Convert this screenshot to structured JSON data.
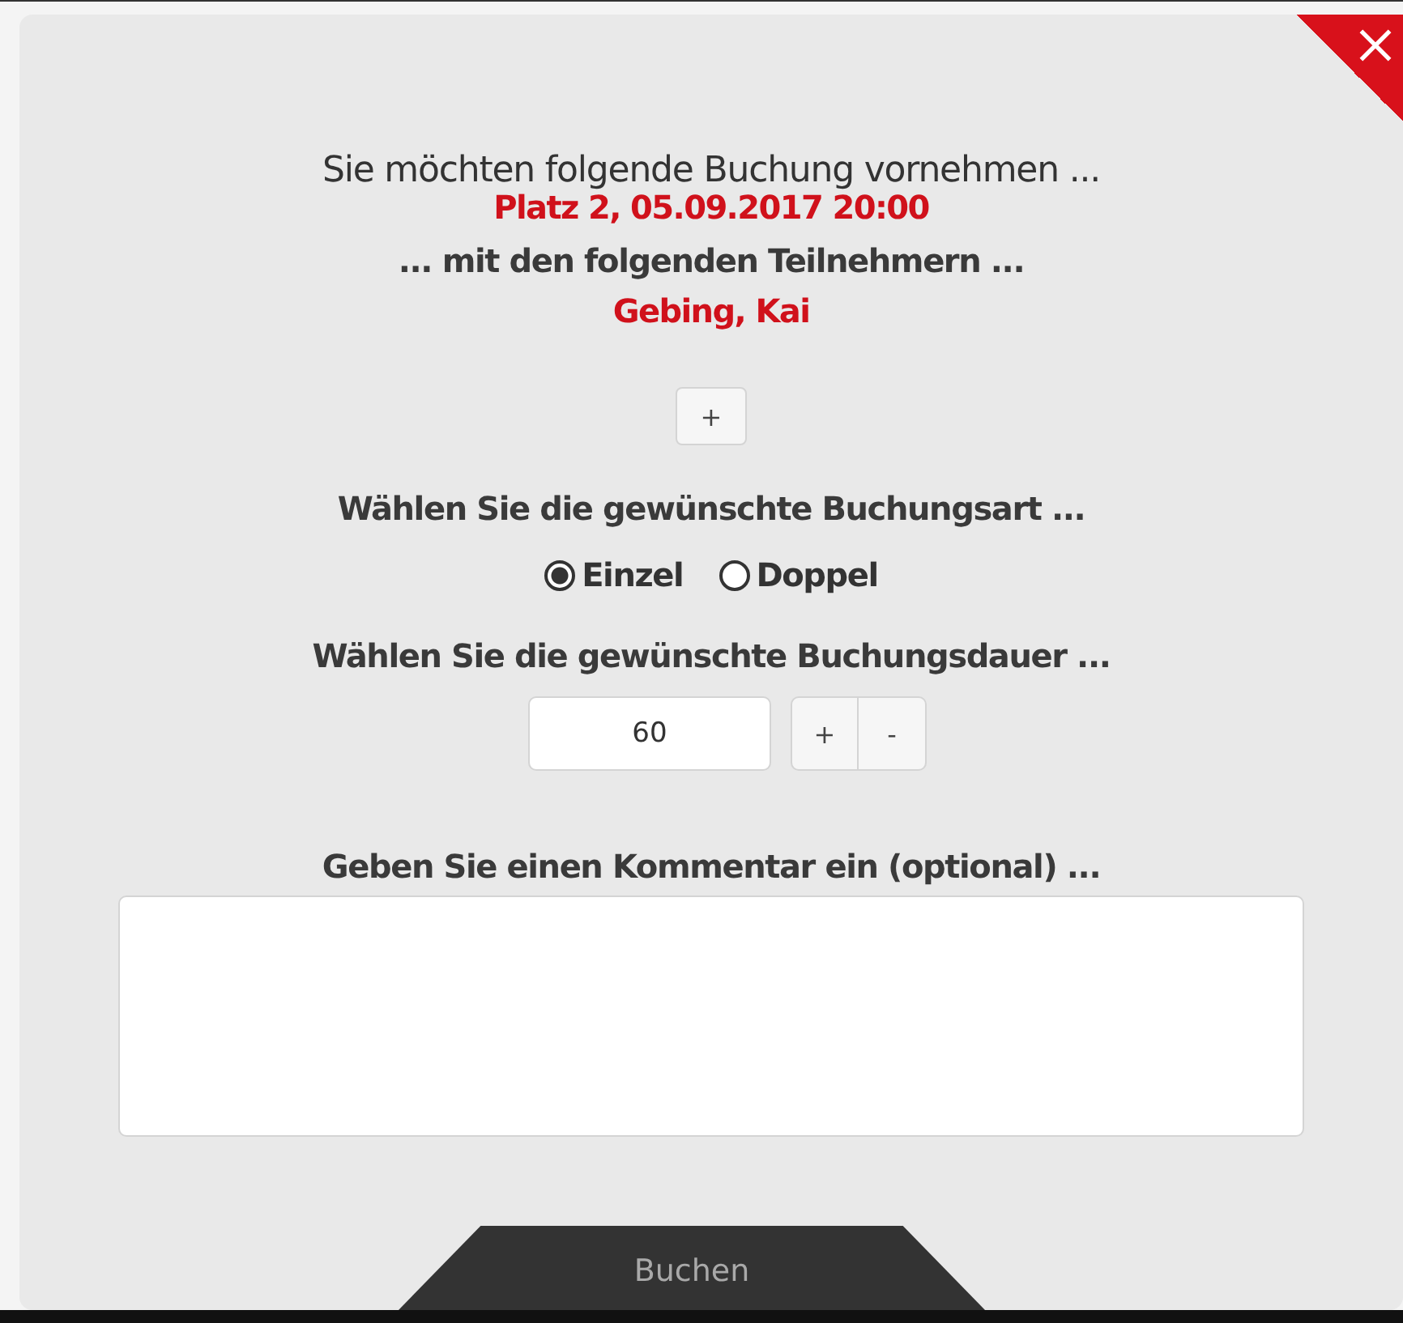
{
  "dialog": {
    "heading": "Sie möchten folgende Buchung vornehmen ...",
    "booking": "Platz 2, 05.09.2017 20:00",
    "participants_label": "... mit den folgenden Teilnehmern ...",
    "participants": [
      "Gebing, Kai"
    ],
    "add_participant_button": "+",
    "type_label": "Wählen Sie die gewünschte Buchungsart ...",
    "type_options": [
      {
        "label": "Einzel",
        "selected": true
      },
      {
        "label": "Doppel",
        "selected": false
      }
    ],
    "duration_label": "Wählen Sie die gewünschte Buchungsdauer ...",
    "duration_value": "60",
    "duration_buttons": [
      {
        "kind": "increase",
        "label": "+"
      },
      {
        "kind": "decrease",
        "label": "-"
      }
    ],
    "comment_label": "Geben Sie einen Kommentar ein (optional) ...",
    "submit_button": "Buchen"
  }
}
